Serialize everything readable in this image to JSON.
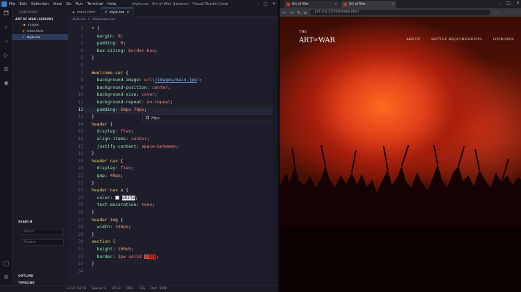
{
  "vscode": {
    "menu": [
      "File",
      "Edit",
      "Selection",
      "View",
      "Go",
      "Run",
      "Terminal",
      "Help"
    ],
    "window_title": "style.css - Art of War (Lesson) - Visual Studio Code",
    "explorer_title": "EXPLORER",
    "project": "ART OF WAR (LESSON)",
    "files": [
      {
        "name": "images",
        "kind": "folder"
      },
      {
        "name": "index.html",
        "kind": "html"
      },
      {
        "name": "style.css",
        "kind": "css",
        "selected": true
      }
    ],
    "search_title": "SEARCH",
    "search_placeholder": "Search",
    "replace_placeholder": "Replace",
    "outline": "OUTLINE",
    "timeline": "TIMELINE",
    "tabs": [
      {
        "label": "index.html",
        "kind": "html"
      },
      {
        "label": "style.css",
        "kind": "css",
        "active": true
      }
    ],
    "breadcrumb": [
      "style.css",
      ">",
      "#welcome-sec"
    ],
    "current_line": 12,
    "suggestion": "70px",
    "status": [
      "Ln 12, Col 15",
      "Spaces: 4",
      "UTF-8",
      "CRLF",
      "CSS",
      "Port : 5500"
    ],
    "code": [
      {
        "n": 1,
        "t": "* {"
      },
      {
        "n": 2,
        "t": "  margin: 0;"
      },
      {
        "n": 3,
        "t": "  padding: 0;"
      },
      {
        "n": 4,
        "t": "  box-sizing: border-box;"
      },
      {
        "n": 5,
        "t": "}"
      },
      {
        "n": 6,
        "t": ""
      },
      {
        "n": 7,
        "t": "#welcome-sec {"
      },
      {
        "n": 8,
        "t": "  background-image: url(/images/main.jpg);"
      },
      {
        "n": 9,
        "t": "  background-position: center;"
      },
      {
        "n": 10,
        "t": "  background-size: cover;"
      },
      {
        "n": 11,
        "t": "  background-repeat: no-repeat;"
      },
      {
        "n": 12,
        "t": "  padding: 50px 70px;"
      },
      {
        "n": 13,
        "t": "}"
      },
      {
        "n": 14,
        "t": "header {"
      },
      {
        "n": 15,
        "t": "  display: flex;"
      },
      {
        "n": 16,
        "t": "  align-items: center;"
      },
      {
        "n": 17,
        "t": "  justify-content: space-between;"
      },
      {
        "n": 18,
        "t": "}"
      },
      {
        "n": 19,
        "t": "header nav {"
      },
      {
        "n": 20,
        "t": "  display: flex;"
      },
      {
        "n": 21,
        "t": "  gap: 40px;"
      },
      {
        "n": 22,
        "t": "}"
      },
      {
        "n": 23,
        "t": "header nav a {"
      },
      {
        "n": 24,
        "t": "  color: white;"
      },
      {
        "n": 25,
        "t": "  text-decoration: none;"
      },
      {
        "n": 26,
        "t": "}"
      },
      {
        "n": 27,
        "t": "header img {"
      },
      {
        "n": 28,
        "t": "  width: 150px;"
      },
      {
        "n": 29,
        "t": "}"
      },
      {
        "n": 30,
        "t": "section {"
      },
      {
        "n": 31,
        "t": "  height: 100vh;"
      },
      {
        "n": 32,
        "t": "  border: 1px solid red;"
      },
      {
        "n": 33,
        "t": "}"
      },
      {
        "n": 34,
        "t": ""
      }
    ]
  },
  "browser": {
    "tabs": [
      {
        "title": "Art of War"
      },
      {
        "title": "Art of War",
        "active": true
      }
    ],
    "url": "127.0.0.1:5500/index.html",
    "brand": {
      "the": "THE",
      "art": "ART",
      "of": "OF",
      "war": "WAR"
    },
    "nav_links": [
      "ABOUT",
      "BATTLE REQUIREMENTS",
      "OPINIONS"
    ]
  },
  "colors": {
    "accent": "#4b9be0",
    "hero": "#e0401a"
  }
}
